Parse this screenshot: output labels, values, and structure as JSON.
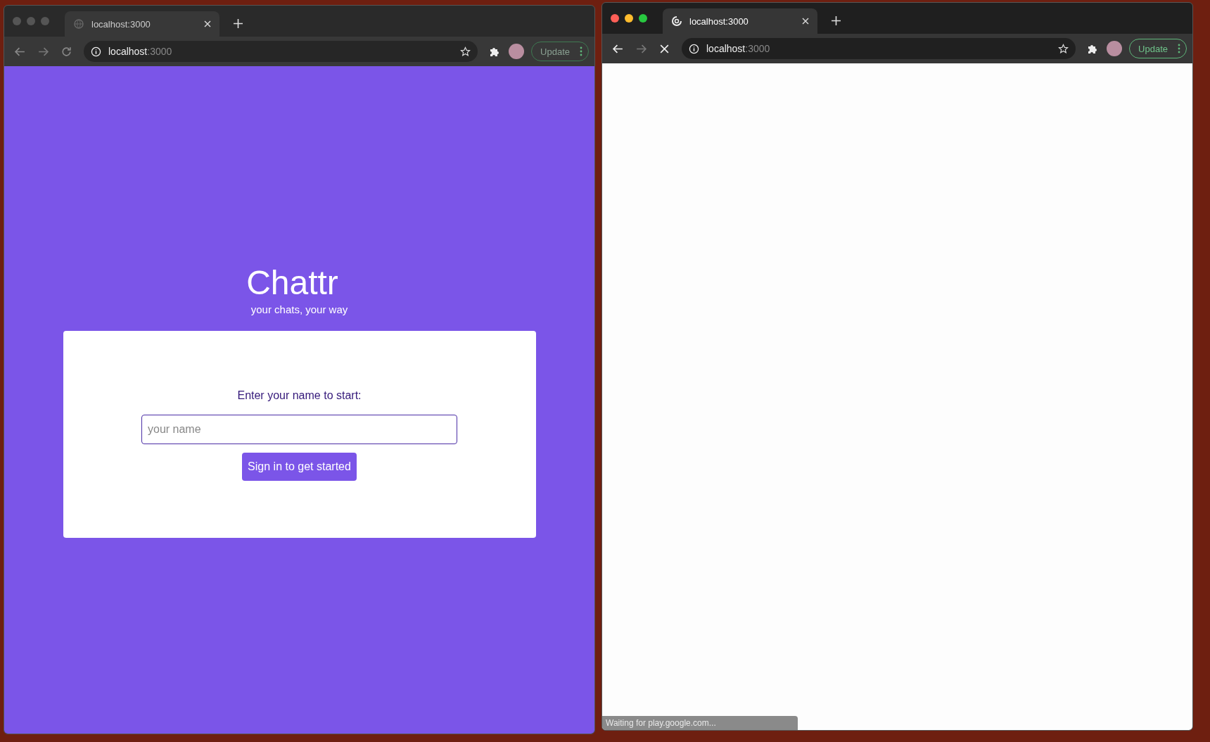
{
  "windows": [
    {
      "focused": false,
      "loading": false,
      "tab": {
        "title": "localhost:3000"
      },
      "address": {
        "host": "localhost",
        "port": ":3000"
      },
      "update_button": "Update",
      "page": {
        "kind": "login",
        "title": "Chattr",
        "subtitle": "your chats, your way",
        "prompt": "Enter your name to start:",
        "name_field": {
          "placeholder": "your name"
        },
        "button": "Sign in to get started"
      }
    },
    {
      "focused": true,
      "loading": true,
      "tab": {
        "title": "localhost:3000"
      },
      "address": {
        "host": "localhost",
        "port": ":3000"
      },
      "update_button": "Update",
      "page": {
        "kind": "blank"
      },
      "status": "Waiting for play.google.com..."
    }
  ]
}
